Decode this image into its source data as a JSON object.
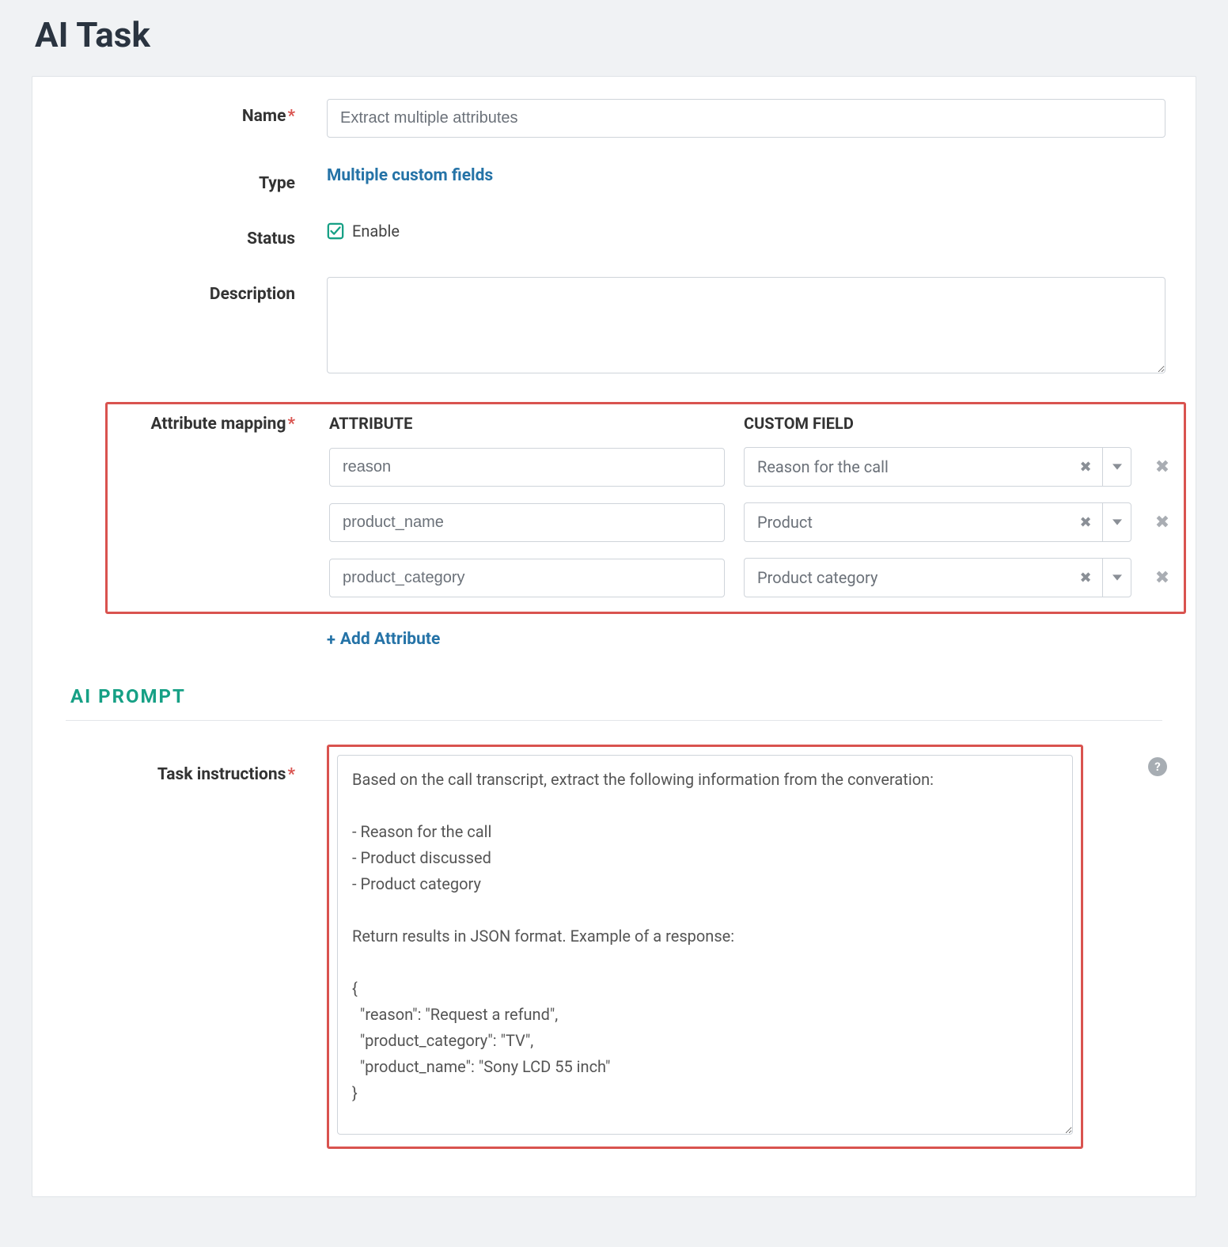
{
  "page_title": "AI Task",
  "form": {
    "name_label": "Name",
    "name_value": "Extract multiple attributes",
    "type_label": "Type",
    "type_value": "Multiple custom fields",
    "status_label": "Status",
    "status_value": "Enable",
    "description_label": "Description",
    "description_value": "",
    "attr_mapping_label": "Attribute mapping",
    "attr_header": "ATTRIBUTE",
    "custom_header": "CUSTOM FIELD",
    "mappings": [
      {
        "attr": "reason",
        "custom": "Reason for the call"
      },
      {
        "attr": "product_name",
        "custom": "Product"
      },
      {
        "attr": "product_category",
        "custom": "Product category"
      }
    ],
    "add_attribute_label": "Add Attribute"
  },
  "prompt_section": {
    "title": "AI  PROMPT",
    "task_instructions_label": "Task instructions",
    "task_instructions_value": "Based on the call transcript, extract the following information from the converation:\n\n- Reason for the call\n- Product discussed\n- Product category\n\nReturn results in JSON format. Example of a response:\n\n{\n  \"reason\": \"Request a refund\",\n  \"product_category\": \"TV\",\n  \"product_name\": \"Sony LCD 55 inch\"\n}"
  }
}
